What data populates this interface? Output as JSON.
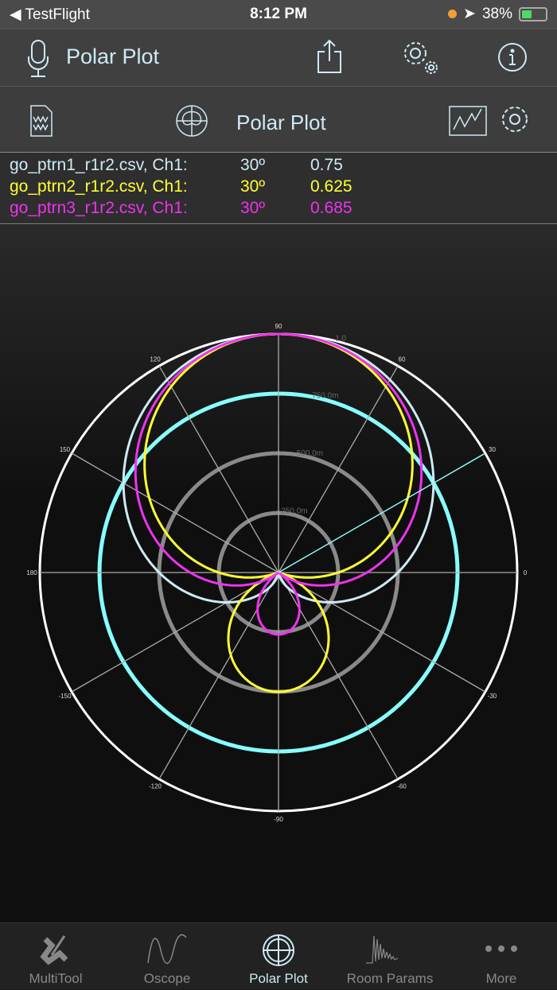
{
  "status_bar": {
    "back_app": "◀ TestFlight",
    "time": "8:12 PM",
    "battery": "38%"
  },
  "nav": {
    "title": "Polar Plot"
  },
  "subheader": {
    "title": "Polar Plot"
  },
  "readouts": [
    {
      "file": "go_ptrn1_r1r2.csv, Ch1:",
      "angle": "30º",
      "value": "0.75",
      "color": "#cdeaf5"
    },
    {
      "file": "go_ptrn2_r1r2.csv, Ch1:",
      "angle": "30º",
      "value": "0.625",
      "color": "#ffff33"
    },
    {
      "file": "go_ptrn3_r1r2.csv, Ch1:",
      "angle": "30º",
      "value": "0.685",
      "color": "#ee33ee"
    }
  ],
  "chart_data": {
    "type": "polar",
    "angle_labels": [
      "0",
      "30",
      "60",
      "90",
      "120",
      "150",
      "180",
      "-150",
      "-120",
      "-90",
      "-60",
      "-30"
    ],
    "radial_labels": [
      "250.0m",
      "500.0m",
      "750.0m",
      "1.0"
    ],
    "radial_ticks": [
      0.25,
      0.5,
      0.75,
      1.0
    ],
    "rmax": 1.0,
    "cursor_angle_deg": 30,
    "cursor_ring": 0.75,
    "series": [
      {
        "name": "go_ptrn1_r1r2.csv",
        "color": "#cdeaf5",
        "a": 0.5,
        "b": 0.5
      },
      {
        "name": "go_ptrn2_r1r2.csv",
        "color": "#ffff33",
        "a": 0.25,
        "b": 0.75
      },
      {
        "name": "go_ptrn3_r1r2.csv",
        "color": "#ee33ee",
        "a": 0.37,
        "b": 0.63
      }
    ]
  },
  "tabs": [
    {
      "label": "MultiTool"
    },
    {
      "label": "Oscope"
    },
    {
      "label": "Polar Plot",
      "active": true
    },
    {
      "label": "Room Params"
    },
    {
      "label": "More"
    }
  ]
}
